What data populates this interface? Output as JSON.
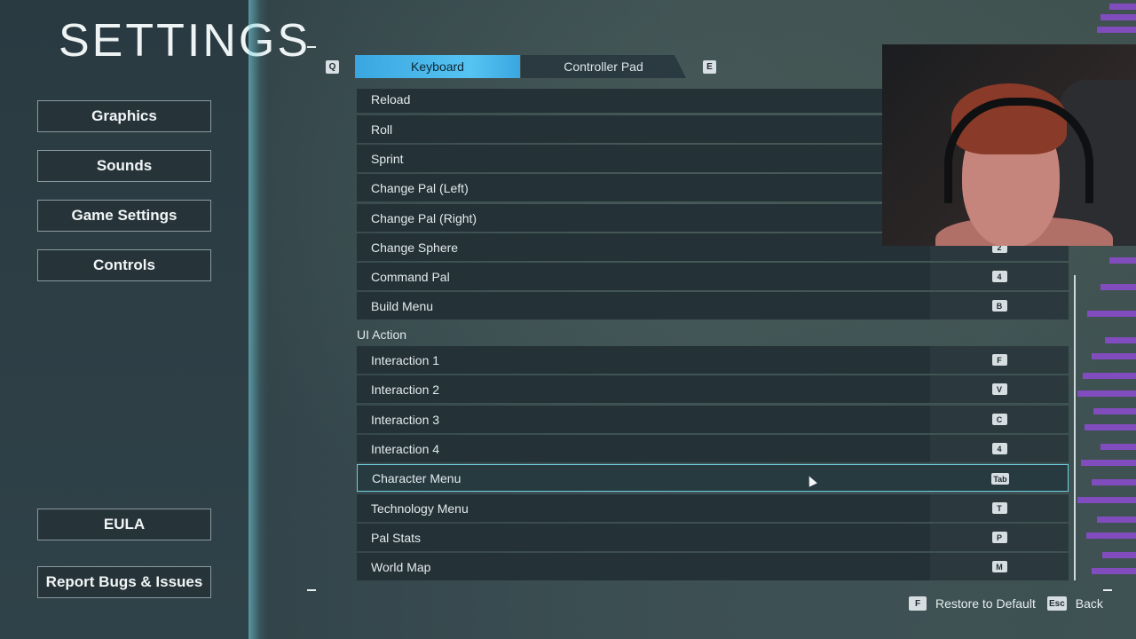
{
  "header": {
    "title": "SETTINGS"
  },
  "sidebar": {
    "items": [
      {
        "label": "Graphics"
      },
      {
        "label": "Sounds"
      },
      {
        "label": "Game Settings"
      },
      {
        "label": "Controls"
      }
    ],
    "eula": "EULA",
    "report": "Report Bugs & Issues"
  },
  "tabs": {
    "prev_key": "Q",
    "next_key": "E",
    "keyboard": "Keyboard",
    "controller": "Controller Pad",
    "active": "Keyboard"
  },
  "bindings": {
    "top_rows": [
      {
        "label": "Reload",
        "key": ""
      },
      {
        "label": "Roll",
        "key": ""
      },
      {
        "label": "Sprint",
        "key": ""
      },
      {
        "label": "Change Pal (Left)",
        "key": ""
      },
      {
        "label": "Change Pal (Right)",
        "key": ""
      },
      {
        "label": "Change Sphere",
        "key": "2"
      },
      {
        "label": "Command Pal",
        "key": "4"
      },
      {
        "label": "Build Menu",
        "key": "B"
      }
    ],
    "section": "UI Action",
    "ui_rows": [
      {
        "label": "Interaction 1",
        "key": "F"
      },
      {
        "label": "Interaction 2",
        "key": "V"
      },
      {
        "label": "Interaction 3",
        "key": "C"
      },
      {
        "label": "Interaction 4",
        "key": "4"
      },
      {
        "label": "Character Menu",
        "key": "Tab"
      },
      {
        "label": "Technology Menu",
        "key": "T"
      },
      {
        "label": "Pal Stats",
        "key": "P"
      },
      {
        "label": "World Map",
        "key": "M"
      }
    ],
    "selected": "Character Menu"
  },
  "footer": {
    "restore_key": "F",
    "restore_label": "Restore to Default",
    "back_key": "Esc",
    "back_label": "Back"
  },
  "colors": {
    "accent": "#56c4f2",
    "selection_border": "#6fd0e0",
    "panel": "#2a3a41"
  }
}
